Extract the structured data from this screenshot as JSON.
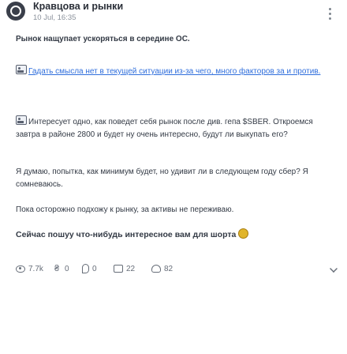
{
  "post": {
    "author": "Кравцова и рынки",
    "timestamp": "10 Jul, 16:35",
    "menu_icon": "more-vertical-icon"
  },
  "content": {
    "p1": "Рынок нащупает ускоряться в середине ОС.",
    "p2_link": "Гадать смысла нет в текущей ситуации из-за чего, много факторов за и против.",
    "p3": "Интересует одно, как поведет себя рынок после див. гепа $SBER. Откроемся завтра в районе 2800 и будет ну очень интересно, будут ли выкупать его?",
    "p4": "Я думаю, попытка, как минимум будет, но удивит ли в следующем году сбер? Я сомневаюсь.",
    "p5": "Пока осторожно подхожу к рынку, за активы не переживаю.",
    "p6": "Сейчас пошуу что-нибудь интересное вам для шорта"
  },
  "stats": {
    "views": "7.7k",
    "donations": "0",
    "reposts": "0",
    "comments": "22",
    "likes": "82"
  },
  "icons": {
    "image": "image-icon",
    "coin_emoji": "coin-emoji-icon",
    "views": "eye-icon",
    "donate": "currency-icon",
    "reposts": "repost-icon",
    "comments": "comment-icon",
    "likes": "heart-icon",
    "edit": "pencil-icon"
  },
  "colors": {
    "link": "#2f6edc",
    "text": "#333a45",
    "muted": "#8b929c"
  }
}
